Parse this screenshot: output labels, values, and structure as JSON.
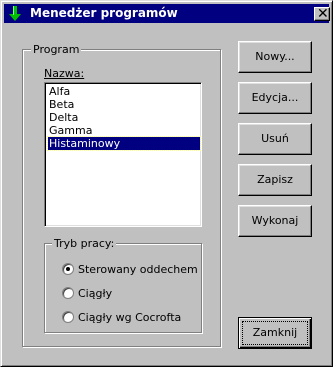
{
  "window": {
    "title": "Menedżer programów",
    "icon": "green-down-arrow-icon",
    "close_glyph": "✕"
  },
  "program_group": {
    "legend": "Program",
    "name_label": "Nazwa:",
    "programs": [
      "Alfa",
      "Beta",
      "Delta",
      "Gamma",
      "Histaminowy"
    ],
    "selected": "Histaminowy"
  },
  "mode_group": {
    "legend": "Tryb pracy:",
    "options": [
      "Sterowany oddechem",
      "Ciągły",
      "Ciągły wg Cocrofta"
    ],
    "selected": "Sterowany oddechem"
  },
  "buttons": {
    "new": "Nowy...",
    "edit": "Edycja...",
    "delete": "Usuń",
    "save": "Zapisz",
    "run": "Wykonaj",
    "close": "Zamknij"
  },
  "colors": {
    "title_bg": "#000080",
    "selection_bg": "#000080",
    "face": "#c0c0c0",
    "icon_green": "#008000"
  }
}
